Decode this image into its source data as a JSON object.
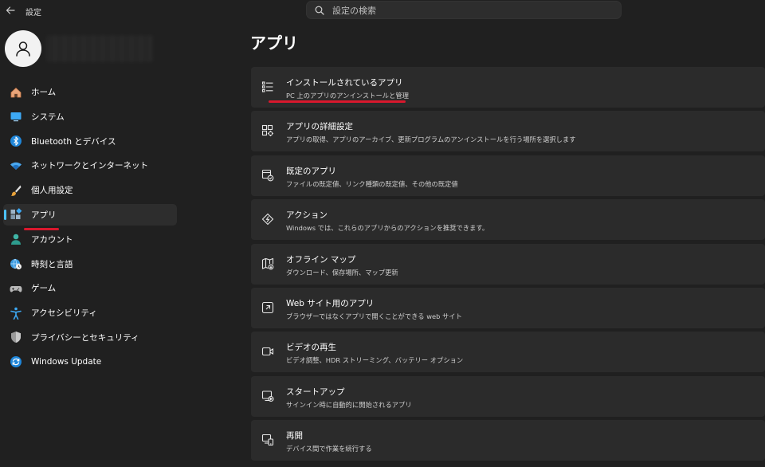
{
  "window": {
    "title": "設定"
  },
  "search": {
    "placeholder": "設定の検索"
  },
  "sidebar": {
    "items": [
      {
        "label": "ホーム",
        "icon": "home-icon"
      },
      {
        "label": "システム",
        "icon": "monitor-icon"
      },
      {
        "label": "Bluetooth とデバイス",
        "icon": "bluetooth-icon"
      },
      {
        "label": "ネットワークとインターネット",
        "icon": "wifi-icon"
      },
      {
        "label": "個人用設定",
        "icon": "brush-icon"
      },
      {
        "label": "アプリ",
        "icon": "apps-icon",
        "selected": true
      },
      {
        "label": "アカウント",
        "icon": "person-icon"
      },
      {
        "label": "時刻と言語",
        "icon": "globe-clock-icon"
      },
      {
        "label": "ゲーム",
        "icon": "gamepad-icon"
      },
      {
        "label": "アクセシビリティ",
        "icon": "accessibility-icon"
      },
      {
        "label": "プライバシーとセキュリティ",
        "icon": "shield-icon"
      },
      {
        "label": "Windows Update",
        "icon": "update-icon"
      }
    ]
  },
  "main": {
    "title": "アプリ",
    "cards": [
      {
        "title": "インストールされているアプリ",
        "subtitle": "PC 上のアプリのアンインストールと管理",
        "icon": "list-icon"
      },
      {
        "title": "アプリの詳細設定",
        "subtitle": "アプリの取得、アプリのアーカイブ、更新プログラムのアンインストールを行う場所を選択します",
        "icon": "app-settings-icon"
      },
      {
        "title": "既定のアプリ",
        "subtitle": "ファイルの既定値、リンク種類の既定値、その他の既定値",
        "icon": "default-apps-icon"
      },
      {
        "title": "アクション",
        "subtitle": "Windows では、これらのアプリからのアクションを推奨できます。",
        "icon": "actions-icon"
      },
      {
        "title": "オフライン マップ",
        "subtitle": "ダウンロード、保存場所、マップ更新",
        "icon": "map-icon"
      },
      {
        "title": "Web サイト用のアプリ",
        "subtitle": "ブラウザーではなくアプリで開くことができる web サイト",
        "icon": "open-external-icon"
      },
      {
        "title": "ビデオの再生",
        "subtitle": "ビデオ調整、HDR ストリーミング、バッテリー オプション",
        "icon": "video-icon"
      },
      {
        "title": "スタートアップ",
        "subtitle": "サインイン時に自動的に開始されるアプリ",
        "icon": "startup-icon"
      },
      {
        "title": "再開",
        "subtitle": "デバイス間で作業を続行する",
        "icon": "resume-icon"
      }
    ]
  },
  "colors": {
    "accent": "#4cc2ff",
    "highlight": "#d9182d",
    "background": "#202020",
    "card": "#2b2b2b"
  }
}
